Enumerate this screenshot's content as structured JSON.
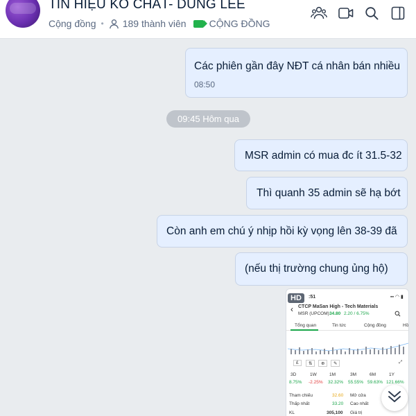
{
  "header": {
    "title": "TÍN HIỆU KO CHÁT- DŨNG LEE",
    "type_label": "Cộng đồng",
    "member_count": "189 thành viên",
    "tag_label": "CỘNG ĐỒNG",
    "icons": [
      "add-member-icon",
      "video-call-icon",
      "search-icon",
      "sidebar-toggle-icon"
    ]
  },
  "messages": [
    {
      "text": "Các phiên gần đây NĐT cá nhân bán nhiều",
      "time": "08:50"
    },
    {
      "text": "MSR admin có mua đc ít 31.5-32"
    },
    {
      "text": "Thì quanh 35 admin sẽ hạ bớt"
    },
    {
      "text": "Còn anh em chú ý nhịp hồi kỳ vọng lên 38-39 đã"
    },
    {
      "text": "(nếu thị trường chung ủng hộ)"
    }
  ],
  "date_divider": "09:45 Hôm qua",
  "image_message": {
    "badge": "HD",
    "status_time": ":51",
    "stock_name": "CTCP MaSan High - Tech Materials",
    "ticker": "MSR (UPCOM)",
    "price": "34.80",
    "change": "2.20 / 6.75%",
    "tabs": [
      "Tổng quan",
      "Tin tức",
      "Cộng đồng",
      "Hồ"
    ],
    "periods": [
      "3D",
      "1W",
      "1M",
      "3M",
      "6M",
      "1Y"
    ],
    "period_values": [
      "8.75%",
      "-2.25%",
      "32.32%",
      "55.55%",
      "59.63%",
      "121.66%"
    ],
    "rows": [
      {
        "l1": "Tham chiếu",
        "v1": "32.60",
        "l2": "Mở cửa",
        "v2": ""
      },
      {
        "l1": "Thấp nhất",
        "v1": "33.20",
        "l2": "Cao nhất",
        "v2": ""
      },
      {
        "l1": "KL",
        "v1": "305,100",
        "l2": "Giá trị",
        "v2": ""
      }
    ],
    "colors": {
      "up": "#1aa64a",
      "down": "#e23b3b",
      "ref": "#e6a817"
    }
  },
  "scroll_button_icon": "chevron-double-down-icon"
}
